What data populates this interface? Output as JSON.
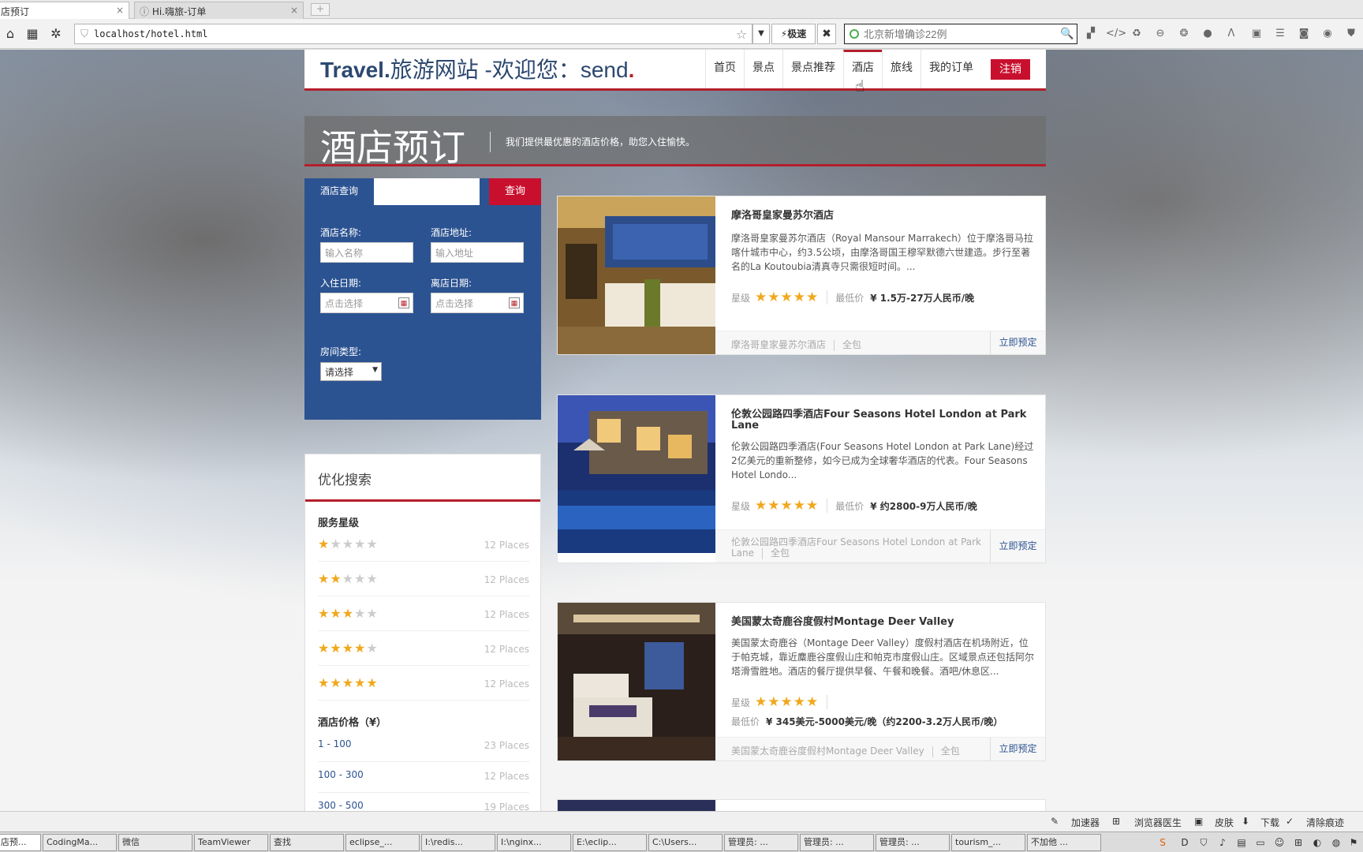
{
  "browser": {
    "tabs": [
      {
        "label": "店预订"
      },
      {
        "label": "Hi.嗨旅-订单"
      }
    ],
    "address": "localhost/hotel.html",
    "speed_label": "极速",
    "search_placeholder": "北京新增确诊22例"
  },
  "site": {
    "logo_brand": "Travel.",
    "logo_text": "旅游网站 -欢迎您：send",
    "logo_dot": ".",
    "nav": [
      {
        "label": "首页"
      },
      {
        "label": "景点"
      },
      {
        "label": "景点推荐"
      },
      {
        "label": "酒店"
      },
      {
        "label": "旅线"
      },
      {
        "label": "我的订单"
      }
    ],
    "logout": "注销",
    "banner_title": "酒店预订",
    "banner_sub": "我们提供最优惠的酒店价格，助您入住愉快。"
  },
  "search": {
    "tab": "酒店查询",
    "button": "查询",
    "name_label": "酒店名称:",
    "name_placeholder": "输入名称",
    "address_label": "酒店地址:",
    "address_placeholder": "输入地址",
    "checkin_label": "入住日期:",
    "checkin_placeholder": "点击选择",
    "checkout_label": "离店日期:",
    "checkout_placeholder": "点击选择",
    "room_label": "房间类型:",
    "room_value": "请选择"
  },
  "filter": {
    "title": "优化搜索",
    "stars_heading": "服务星级",
    "star_rows": [
      {
        "stars": 1,
        "count": "12 Places"
      },
      {
        "stars": 2,
        "count": "12 Places"
      },
      {
        "stars": 3,
        "count": "12 Places"
      },
      {
        "stars": 4,
        "count": "12 Places"
      },
      {
        "stars": 5,
        "count": "12 Places"
      }
    ],
    "price_heading": "酒店价格（¥）",
    "price_rows": [
      {
        "range": "1 - 100",
        "count": "23 Places"
      },
      {
        "range": "100 - 300",
        "count": "12 Places"
      },
      {
        "range": "300 - 500",
        "count": "19 Places"
      }
    ]
  },
  "hotels": [
    {
      "name": "摩洛哥皇家曼苏尔酒店",
      "desc": "摩洛哥皇家曼苏尔酒店（Royal Mansour Marrakech）位于摩洛哥马拉喀什城市中心，约3.5公顷，由摩洛哥国王穆罕默德六世建造。步行至著名的La Koutoubia清真寺只需很短时间。...",
      "star_label": "星级",
      "stars": 5,
      "price_label": "最低价",
      "price": "¥ 1.5万-27万人民币/晚",
      "footer_name": "摩洛哥皇家曼苏尔酒店",
      "footer_tag": "全包",
      "book": "立即预定"
    },
    {
      "name": "伦敦公园路四季酒店Four Seasons Hotel London at Park Lane",
      "desc": "伦敦公园路四季酒店(Four Seasons Hotel London at Park Lane)经过2亿美元的重新整修，如今已成为全球奢华酒店的代表。Four Seasons Hotel Londo...",
      "star_label": "星级",
      "stars": 5,
      "price_label": "最低价",
      "price": "¥ 约2800-9万人民币/晚",
      "footer_name": "伦敦公园路四季酒店Four Seasons Hotel London at Park Lane",
      "footer_tag": "全包",
      "book": "立即预定"
    },
    {
      "name": "美国蒙太奇鹿谷度假村Montage Deer Valley",
      "desc": "美国蒙太奇鹿谷（Montage Deer Valley）度假村酒店在机场附近，位于帕克城，靠近麋鹿谷度假山庄和帕克市度假山庄。区域景点还包括阿尔塔滑雪胜地。酒店的餐厅提供早餐、午餐和晚餐。酒吧/休息区...",
      "star_label": "星级",
      "stars": 5,
      "price_label": "最低价",
      "price": "¥ 345美元-5000美元/晚（约2200-3.2万人民币/晚）",
      "footer_name": "美国蒙太奇鹿谷度假村Montage Deer Valley",
      "footer_tag": "全包",
      "book": "立即预定"
    }
  ],
  "status_bar": [
    "加速器",
    "浏览器医生",
    "皮肤",
    "下载",
    "清除痕迹"
  ],
  "taskbar": [
    {
      "label": "店预..."
    },
    {
      "label": "CodingMa..."
    },
    {
      "label": "微信"
    },
    {
      "label": "TeamViewer"
    },
    {
      "label": "查找"
    },
    {
      "label": "eclipse_..."
    },
    {
      "label": "I:\\redis..."
    },
    {
      "label": "I:\\nginx..."
    },
    {
      "label": "E:\\eclip..."
    },
    {
      "label": "C:\\Users..."
    },
    {
      "label": "管理员: ..."
    },
    {
      "label": "管理员: ..."
    },
    {
      "label": "管理员: ..."
    },
    {
      "label": "tourism_..."
    },
    {
      "label": "不加他 ..."
    }
  ]
}
